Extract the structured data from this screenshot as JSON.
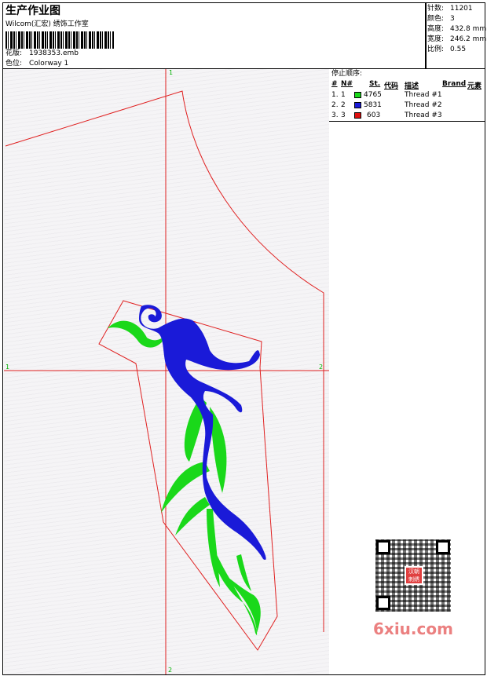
{
  "header": {
    "title": "生产作业图",
    "company": "Wilcom(汇宏) 绣饰工作室",
    "file_label": "花版:",
    "file_value": "1938353.emb",
    "colorway_label": "色位:",
    "colorway_value": "Colorway 1"
  },
  "stats": [
    {
      "label": "针数:",
      "value": "11201"
    },
    {
      "label": "颜色:",
      "value": "3"
    },
    {
      "label": "高度:",
      "value": "432.8 mm"
    },
    {
      "label": "宽度:",
      "value": "246.2 mm"
    },
    {
      "label": "比例:",
      "value": "0.55"
    }
  ],
  "stop_sequence": {
    "title": "停止顺序:",
    "headers": {
      "num": "#",
      "n": "N#",
      "st": "St.",
      "code": "代码",
      "desc": "描述",
      "brand": "Brand",
      "element": "元素"
    },
    "rows": [
      {
        "num": "1.",
        "n": "1",
        "color": "#1ad81a",
        "code": "4765",
        "desc": "Thread #1"
      },
      {
        "num": "2.",
        "n": "2",
        "color": "#1a1ad8",
        "code": "5831",
        "desc": "Thread #2"
      },
      {
        "num": "3.",
        "n": "3",
        "color": "#e01010",
        "code": "603",
        "desc": "Thread #3"
      }
    ]
  },
  "guides": {
    "top": "1",
    "left": "1",
    "right": "2",
    "bottom": "2"
  },
  "watermark": {
    "text": "6xiu.com",
    "seal": "汉朝刺绣"
  },
  "colors": {
    "outline": "#e02020",
    "thread1": "#1ad81a",
    "thread2": "#1a1ad8",
    "guide_label": "#00b000"
  }
}
